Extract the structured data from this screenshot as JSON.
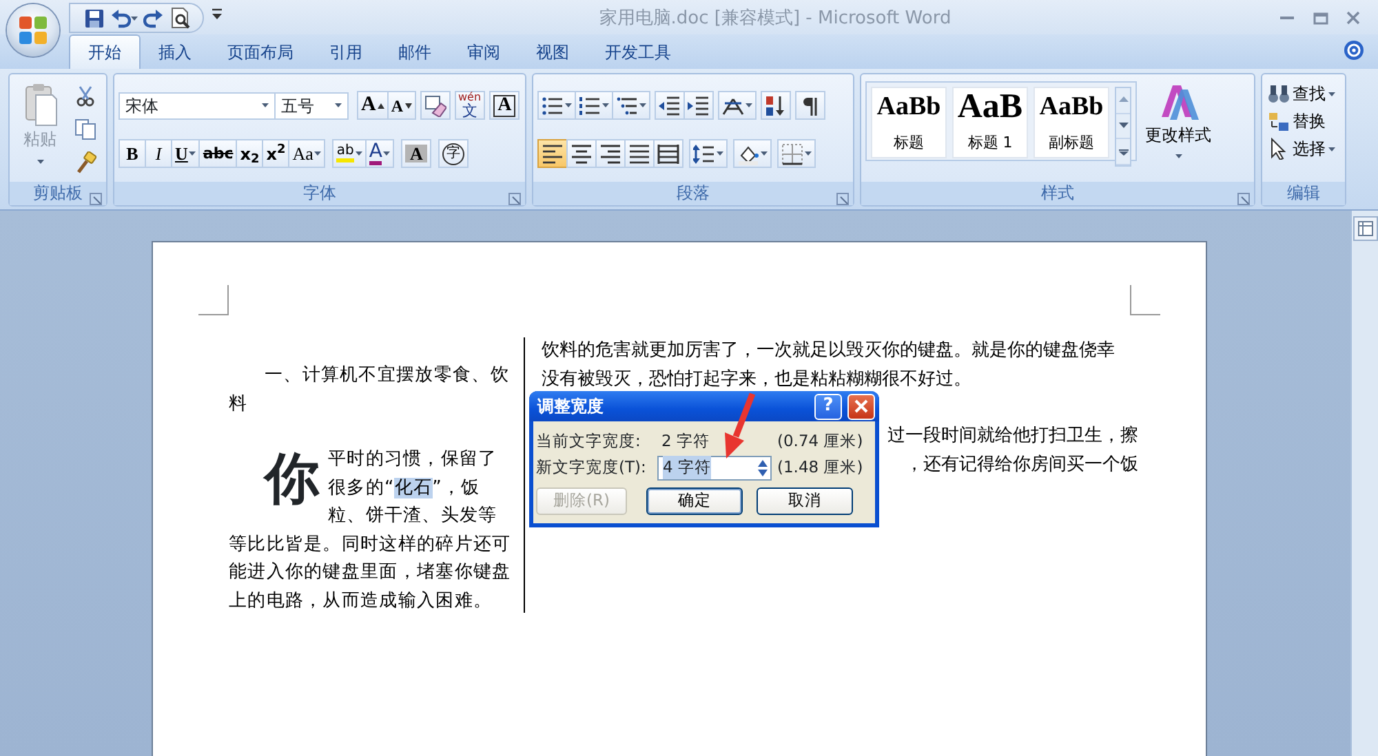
{
  "window": {
    "title": "家用电脑.doc [兼容模式] - Microsoft Word"
  },
  "tabs": [
    {
      "label": "开始",
      "selected": true
    },
    {
      "label": "插入",
      "selected": false
    },
    {
      "label": "页面布局",
      "selected": false
    },
    {
      "label": "引用",
      "selected": false
    },
    {
      "label": "邮件",
      "selected": false
    },
    {
      "label": "审阅",
      "selected": false
    },
    {
      "label": "视图",
      "selected": false
    },
    {
      "label": "开发工具",
      "selected": false
    }
  ],
  "ribbon": {
    "groups": [
      {
        "kind": "clipboard",
        "label": "剪贴板",
        "paste": {
          "label": "粘贴",
          "disabled": true,
          "dropdown": true
        }
      },
      {
        "kind": "font",
        "label": "字体",
        "face": "宋体",
        "size": "五号",
        "row1": [
          {
            "kind": "grow",
            "text": "A"
          },
          {
            "kind": "shrink",
            "text": "A"
          },
          {
            "kind": "clear"
          },
          {
            "kind": "phonetic",
            "text": "wén",
            "sub": "文"
          },
          {
            "kind": "border",
            "text": "A"
          }
        ],
        "row2": [
          {
            "kind": "bold",
            "text": "B"
          },
          {
            "kind": "italic",
            "text": "I"
          },
          {
            "kind": "underline",
            "text": "U",
            "dropdown": true
          },
          {
            "kind": "strike",
            "text": "abc"
          },
          {
            "kind": "sub",
            "text": "x$_{2}$"
          },
          {
            "kind": "sup",
            "text": "x$^{2}$"
          },
          {
            "kind": "case",
            "text": "Aa",
            "dropdown": true
          },
          {
            "kind": "highlight",
            "text": "ab",
            "dropdown": true
          },
          {
            "kind": "color",
            "text": "A",
            "dropdown": true
          },
          {
            "kind": "shade",
            "text": "A"
          },
          {
            "kind": "enclose",
            "text": "字"
          }
        ]
      },
      {
        "kind": "paragraph",
        "label": "段落",
        "row1": [
          {
            "kind": "bullets",
            "dropdown": true
          },
          {
            "kind": "numbering",
            "dropdown": true
          },
          {
            "kind": "multilevel",
            "dropdown": true
          },
          {
            "kind": "outdent"
          },
          {
            "kind": "indent"
          },
          {
            "kind": "asian-layout",
            "dropdown": true
          },
          {
            "kind": "sort"
          },
          {
            "kind": "marks"
          }
        ],
        "row2": [
          {
            "kind": "align-left",
            "selected": true
          },
          {
            "kind": "align-center",
            "selected": false
          },
          {
            "kind": "align-right",
            "selected": false
          },
          {
            "kind": "justify",
            "selected": false
          },
          {
            "kind": "distribute",
            "selected": false
          },
          {
            "kind": "line-spacing",
            "dropdown": true
          },
          {
            "kind": "shading",
            "dropdown": true
          },
          {
            "kind": "borders",
            "dropdown": true
          }
        ]
      },
      {
        "kind": "styles",
        "label": "样式",
        "gallery": [
          {
            "preview": "AaBb",
            "name": "标题"
          },
          {
            "preview": "AaB",
            "name": "标题 1"
          },
          {
            "preview": "AaBb",
            "name": "副标题"
          }
        ],
        "change": {
          "label": "更改样式",
          "dropdown": true
        }
      },
      {
        "kind": "editing",
        "label": "编辑",
        "items": [
          {
            "kind": "find",
            "label": "查找",
            "dropdown": true
          },
          {
            "kind": "replace",
            "label": "替换",
            "dropdown": false
          },
          {
            "kind": "select",
            "label": "选择",
            "dropdown": true
          }
        ]
      }
    ]
  },
  "document": {
    "left_column": [
      {
        "kind": "heading",
        "text": "一、计算机不宜摆放零食、饮料"
      },
      {
        "kind": "dropcap",
        "initial": "你",
        "segments": [
          {
            "text": "平时的习惯，保留了很多的“",
            "selected": false
          },
          {
            "text": "化石",
            "selected": true
          },
          {
            "text": "”，饭粒、饼干渣、头发等等比比皆是。同时这样的碎片还可能进入你的键盘里面，堵塞你键盘上的电路，从而造成输入困难。",
            "selected": false
          }
        ]
      }
    ],
    "right_column": [
      {
        "kind": "paragraph",
        "text": "饮料的危害就更加厉害了，一次就足以毁灭你的键盘。就是你的键盘侥幸没有被毁灭，恐怕打起字来，也是粘粘糊糊很不好过。"
      },
      {
        "kind": "partial",
        "lines": [
          "过一段时间就给他打扫卫生，擦",
          "，还有记得给你房间买一个饭"
        ]
      }
    ]
  },
  "dialog": {
    "title": "调整宽度",
    "help": "?",
    "fields": [
      {
        "kind": "readout",
        "label": "当前文字宽度:",
        "value": "2 字符",
        "unit": "(0.74 厘米)"
      },
      {
        "kind": "spin",
        "label": "新文字宽度(T):",
        "value": "4 字符",
        "text_selected": true,
        "unit": "(1.48 厘米)"
      }
    ],
    "buttons": [
      {
        "label": "删除(R)",
        "disabled": true,
        "default": false
      },
      {
        "label": "确定",
        "disabled": false,
        "default": true
      },
      {
        "label": "取消",
        "disabled": false,
        "default": false
      }
    ]
  }
}
